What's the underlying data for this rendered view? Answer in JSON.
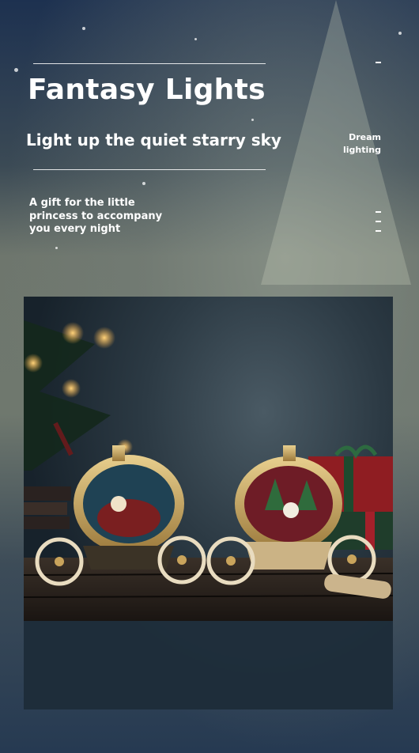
{
  "header": {
    "title": "Fantasy Lights",
    "subtitle": "Light up the quiet starry sky"
  },
  "side_label": {
    "line1": "Dream",
    "line2": "lighting"
  },
  "tagline": "A gift for the little princess to accompany you every night",
  "product_image": {
    "alt": "Two golden pumpkin-carriage snow globe lanterns with Santa and snowman scenes on a wooden table"
  },
  "colors": {
    "gold": "#c8a15a",
    "sky_top": "#1d3150",
    "sky_mid": "#6e766d"
  }
}
